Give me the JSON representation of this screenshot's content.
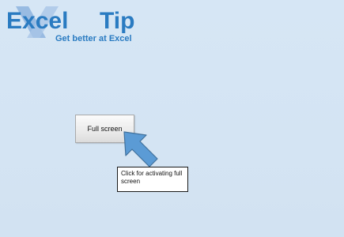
{
  "logo": {
    "brand_part1": "Excel",
    "brand_part2": "Tip",
    "tagline": "Get better at Excel",
    "colors": {
      "primary": "#2a7bc1",
      "accent_x": "#6f9fd0"
    }
  },
  "sheet": {
    "button_label": "Full screen",
    "callout_text": "Click for activating full screen",
    "arrow_icon": "arrow-up-left-icon",
    "colors": {
      "background": "#d5e5f4",
      "arrow_fill": "#5b9bd5",
      "arrow_stroke": "#41719c"
    }
  }
}
